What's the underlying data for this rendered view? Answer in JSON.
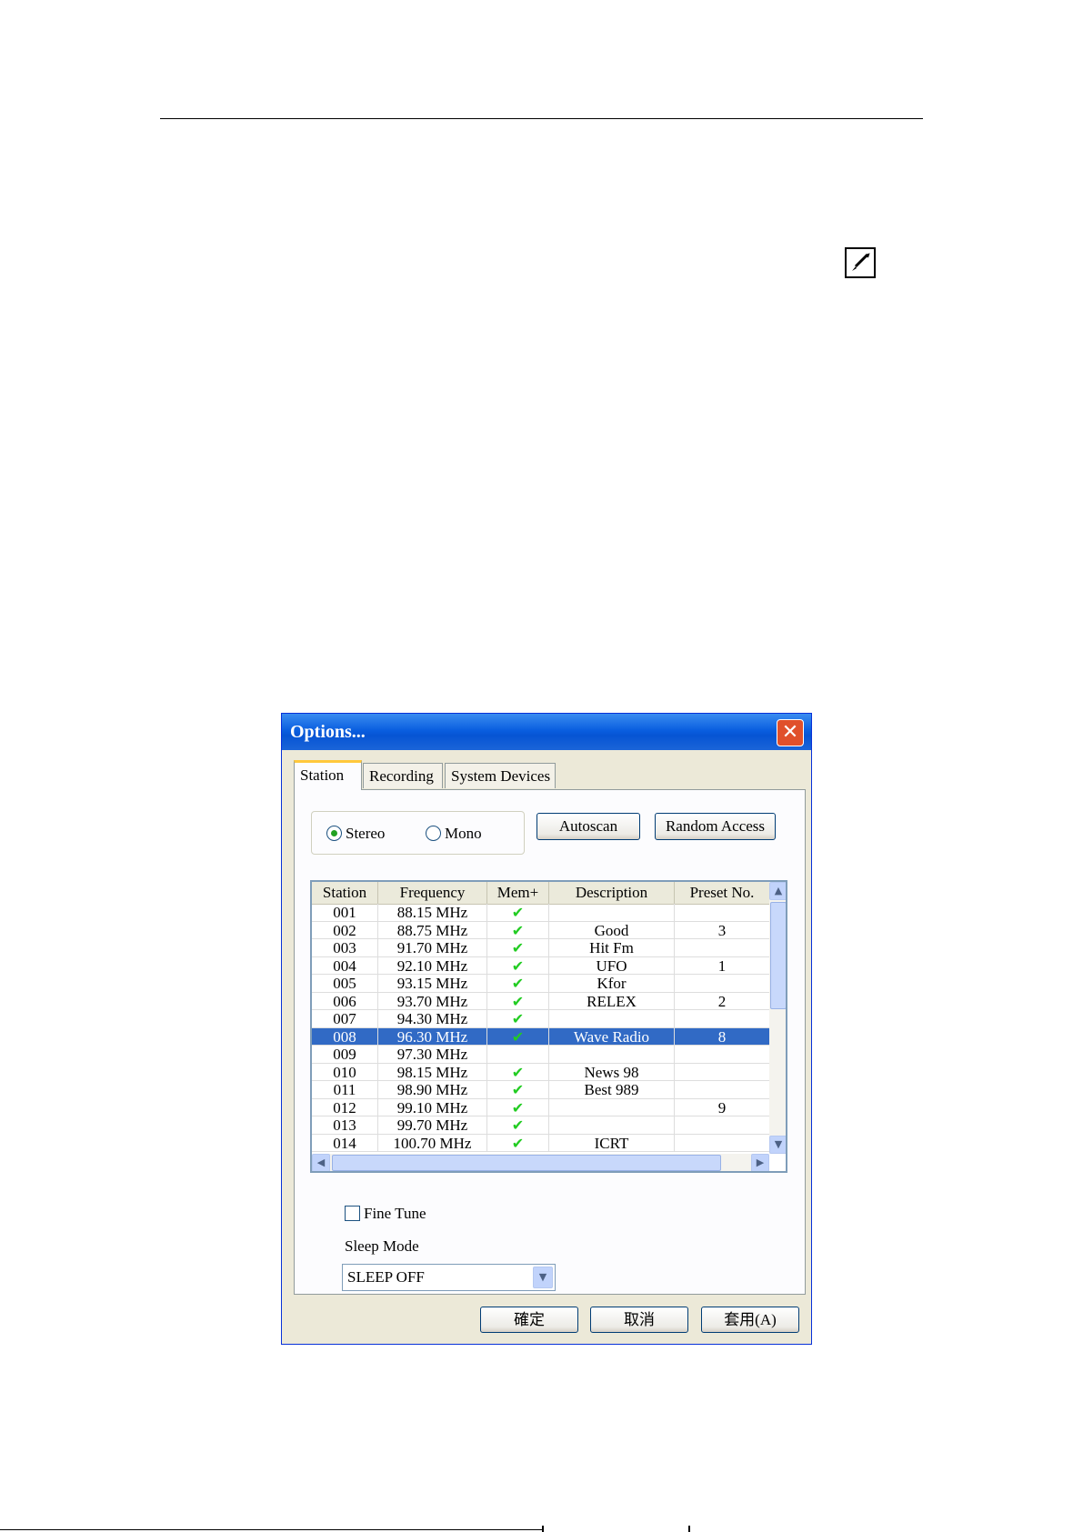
{
  "dialog": {
    "title": "Options...",
    "close_label": "✕"
  },
  "tabs": [
    {
      "label": "Station"
    },
    {
      "label": "Recording"
    },
    {
      "label": "System Devices"
    }
  ],
  "station": {
    "mode_options": [
      {
        "label": "Stereo",
        "selected": true
      },
      {
        "label": "Mono",
        "selected": false
      }
    ],
    "autoscan_label": "Autoscan",
    "random_access_label": "Random Access",
    "columns": [
      "Station",
      "Frequency",
      "Mem+",
      "Description",
      "Preset No."
    ],
    "rows": [
      {
        "station": "001",
        "frequency": "88.15 MHz",
        "mem": true,
        "description": "",
        "preset": ""
      },
      {
        "station": "002",
        "frequency": "88.75 MHz",
        "mem": true,
        "description": "Good",
        "preset": "3"
      },
      {
        "station": "003",
        "frequency": "91.70 MHz",
        "mem": true,
        "description": "Hit Fm",
        "preset": ""
      },
      {
        "station": "004",
        "frequency": "92.10 MHz",
        "mem": true,
        "description": "UFO",
        "preset": "1"
      },
      {
        "station": "005",
        "frequency": "93.15 MHz",
        "mem": true,
        "description": "Kfor",
        "preset": ""
      },
      {
        "station": "006",
        "frequency": "93.70 MHz",
        "mem": true,
        "description": "RELEX",
        "preset": "2"
      },
      {
        "station": "007",
        "frequency": "94.30 MHz",
        "mem": true,
        "description": "",
        "preset": ""
      },
      {
        "station": "008",
        "frequency": "96.30 MHz",
        "mem": true,
        "description": "Wave Radio",
        "preset": "8",
        "selected": true
      },
      {
        "station": "009",
        "frequency": "97.30 MHz",
        "mem": false,
        "description": "",
        "preset": ""
      },
      {
        "station": "010",
        "frequency": "98.15 MHz",
        "mem": true,
        "description": "News 98",
        "preset": ""
      },
      {
        "station": "011",
        "frequency": "98.90 MHz",
        "mem": true,
        "description": "Best 989",
        "preset": ""
      },
      {
        "station": "012",
        "frequency": "99.10 MHz",
        "mem": true,
        "description": "",
        "preset": "9"
      },
      {
        "station": "013",
        "frequency": "99.70 MHz",
        "mem": true,
        "description": "",
        "preset": ""
      },
      {
        "station": "014",
        "frequency": "100.70 MHz",
        "mem": true,
        "description": "ICRT",
        "preset": ""
      }
    ],
    "fine_tune_label": "Fine Tune",
    "fine_tune_checked": false,
    "sleep_mode_label": "Sleep Mode",
    "sleep_mode_value": "SLEEP OFF"
  },
  "footer": {
    "ok_label": "確定",
    "cancel_label": "取消",
    "apply_label": "套用(A)"
  },
  "icons": {
    "pen": "pen-icon",
    "check": "✔"
  },
  "colors": {
    "titlebar": "#0a5fe0",
    "selection": "#316ac5",
    "check": "#22cc22"
  }
}
